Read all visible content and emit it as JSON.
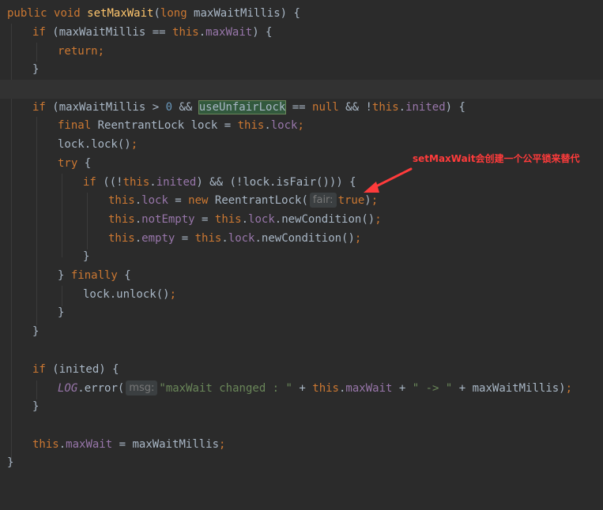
{
  "code": {
    "l1": {
      "public": "public",
      "void": "void",
      "method_name": "setMaxWait",
      "open_paren": "(",
      "long": "long",
      "param": " maxWaitMillis",
      "close": ") {"
    },
    "l2": {
      "if": "if",
      "open": " (maxWaitMillis == ",
      "this": "this",
      "dot": ".",
      "field": "maxWait",
      "close": ") {"
    },
    "l3": {
      "return": "return",
      "semi": ";"
    },
    "l4": {
      "brace": "}"
    },
    "l6": {
      "if": "if",
      "open": " (maxWaitMillis > ",
      "zero": "0",
      "and": " && ",
      "use_unfair_lock": "useUnfairLock",
      "eq": " == ",
      "null": "null",
      "and2": " && !",
      "this": "this",
      "dot": ".",
      "inited": "inited",
      "close": ") {"
    },
    "l7": {
      "final": "final",
      "type": " ReentrantLock lock = ",
      "this": "this",
      "dot": ".",
      "lock": "lock",
      "semi": ";"
    },
    "l8": {
      "call": "lock.lock()",
      "semi": ";"
    },
    "l9": {
      "try": "try",
      "brace": " {"
    },
    "l10": {
      "if": "if",
      "open": " ((!",
      "this": "this",
      "dot": ".",
      "inited": "inited",
      "rest": ") && (!lock.isFair())) {"
    },
    "l11": {
      "this": "this",
      "dot": ".",
      "lock": "lock",
      "eq": " = ",
      "new": "new",
      "ctor": " ReentrantLock(",
      "hint": "fair:",
      "true": "true",
      "close": ")",
      "semi": ";"
    },
    "l12": {
      "this": "this",
      "dot": ".",
      "field": "notEmpty",
      "eq": " = ",
      "this2": "this",
      "dot2": ".",
      "lock": "lock",
      "call": ".newCondition()",
      "semi": ";"
    },
    "l13": {
      "this": "this",
      "dot": ".",
      "field": "empty",
      "eq": " = ",
      "this2": "this",
      "dot2": ".",
      "lock": "lock",
      "call": ".newCondition()",
      "semi": ";"
    },
    "l14": {
      "brace": "}"
    },
    "l15": {
      "brace": "} ",
      "finally": "finally",
      "open": " {"
    },
    "l16": {
      "call": "lock.unlock()",
      "semi": ";"
    },
    "l17": {
      "brace": "}"
    },
    "l18": {
      "brace": "}"
    },
    "l20": {
      "if": "if",
      "cond": " (inited) {"
    },
    "l21": {
      "log": "LOG",
      "call": ".error(",
      "hint": "msg:",
      "str1": "\"maxWait changed : \"",
      "plus1": " + ",
      "this": "this",
      "dot": ".",
      "field": "maxWait",
      "plus2": " + ",
      "str2": "\" -> \"",
      "plus3": " + maxWaitMillis)",
      "semi": ";"
    },
    "l22": {
      "brace": "}"
    },
    "l24": {
      "this": "this",
      "dot": ".",
      "field": "maxWait",
      "eq": " = maxWaitMillis",
      "semi": ";"
    },
    "l25": {
      "brace": "}"
    }
  },
  "annotation": {
    "text": "setMaxWait会创建一个公平锁来替代",
    "color": "#ff3b3b"
  },
  "colors": {
    "background": "#2b2b2b",
    "keyword": "#cc7832",
    "method": "#ffc66d",
    "field": "#9876aa",
    "number": "#6897bb",
    "string": "#6a8759",
    "text": "#a9b7c6"
  }
}
